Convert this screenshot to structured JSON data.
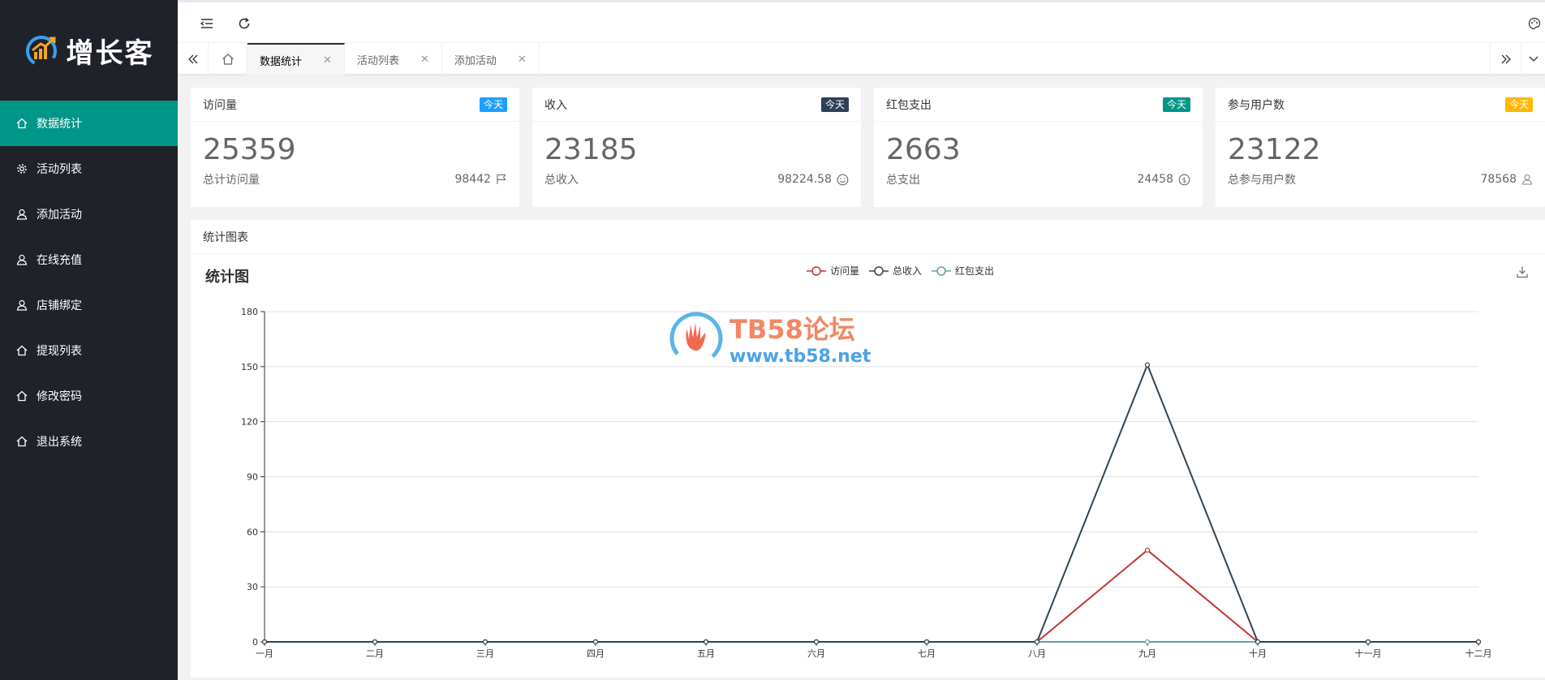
{
  "app": {
    "logo_text": "增长客"
  },
  "sidebar": {
    "items": [
      {
        "label": "数据统计",
        "icon": "home-icon",
        "active": true
      },
      {
        "label": "活动列表",
        "icon": "gear-icon",
        "active": false
      },
      {
        "label": "添加活动",
        "icon": "user-icon",
        "active": false
      },
      {
        "label": "在线充值",
        "icon": "user-icon",
        "active": false
      },
      {
        "label": "店铺绑定",
        "icon": "user-icon",
        "active": false
      },
      {
        "label": "提现列表",
        "icon": "home-icon",
        "active": false
      },
      {
        "label": "修改密码",
        "icon": "home-icon",
        "active": false
      },
      {
        "label": "退出系统",
        "icon": "home-icon",
        "active": false
      }
    ]
  },
  "tabs": [
    {
      "label": "数据统计",
      "active": true
    },
    {
      "label": "活动列表",
      "active": false
    },
    {
      "label": "添加活动",
      "active": false
    }
  ],
  "stats": [
    {
      "title": "访问量",
      "badge": "今天",
      "badge_color": "#1e9fff",
      "value": "25359",
      "foot_label": "总计访问量",
      "foot_value": "98442",
      "foot_icon": "flag-icon"
    },
    {
      "title": "收入",
      "badge": "今天",
      "badge_color": "#2f4056",
      "value": "23185",
      "foot_label": "总收入",
      "foot_value": "98224.58",
      "foot_icon": "smile-icon"
    },
    {
      "title": "红包支出",
      "badge": "今天",
      "badge_color": "#009688",
      "value": "2663",
      "foot_label": "总支出",
      "foot_value": "24458",
      "foot_icon": "dollar-icon"
    },
    {
      "title": "参与用户数",
      "badge": "今天",
      "badge_color": "#ffb800",
      "value": "23122",
      "foot_label": "总参与用户数",
      "foot_value": "78568",
      "foot_icon": "user-icon"
    }
  ],
  "chart_section": {
    "header": "统计图表"
  },
  "watermark": {
    "line1": "TB58论坛",
    "line2": "www.tb58.net"
  },
  "chart_data": {
    "type": "line",
    "title": "统计图",
    "categories": [
      "一月",
      "二月",
      "三月",
      "四月",
      "五月",
      "六月",
      "七月",
      "八月",
      "九月",
      "十月",
      "十一月",
      "十二月"
    ],
    "series": [
      {
        "name": "访问量",
        "color": "#c23531",
        "values": [
          0,
          0,
          0,
          0,
          0,
          0,
          0,
          0,
          50,
          0,
          0,
          0
        ]
      },
      {
        "name": "总收入",
        "color": "#2f4554",
        "values": [
          0,
          0,
          0,
          0,
          0,
          0,
          0,
          0,
          151,
          0,
          0,
          0
        ]
      },
      {
        "name": "红包支出",
        "color": "#61a0a8",
        "values": [
          0,
          0,
          0,
          0,
          0,
          0,
          0,
          0,
          0,
          0,
          0,
          0
        ]
      }
    ],
    "ylim": [
      0,
      180
    ],
    "yticks": [
      0,
      30,
      60,
      90,
      120,
      150,
      180
    ],
    "grid": true,
    "legend_position": "top-center"
  }
}
